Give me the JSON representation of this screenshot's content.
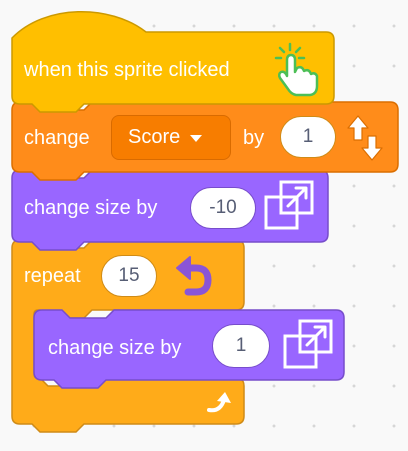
{
  "colors": {
    "events": "#ffbf00",
    "variables": "#ff8c1a",
    "looks": "#9966ff",
    "control": "#ffab19",
    "hand": "#4cbf56"
  },
  "blocks": {
    "hat": {
      "label": "when this sprite clicked",
      "icon": "hand-pointer-icon"
    },
    "change_var": {
      "label": "change",
      "variable": "Score",
      "by_label": "by",
      "value": "1",
      "icon": "variable-arrows-icon"
    },
    "change_size_1": {
      "label": "change size by",
      "value": "-10",
      "icon": "resize-icon"
    },
    "repeat": {
      "label": "repeat",
      "value": "15",
      "icon": "repeat-arrow-icon",
      "loop_icon": "loop-return-icon",
      "inner": {
        "label": "change size by",
        "value": "1",
        "icon": "resize-icon"
      }
    }
  }
}
